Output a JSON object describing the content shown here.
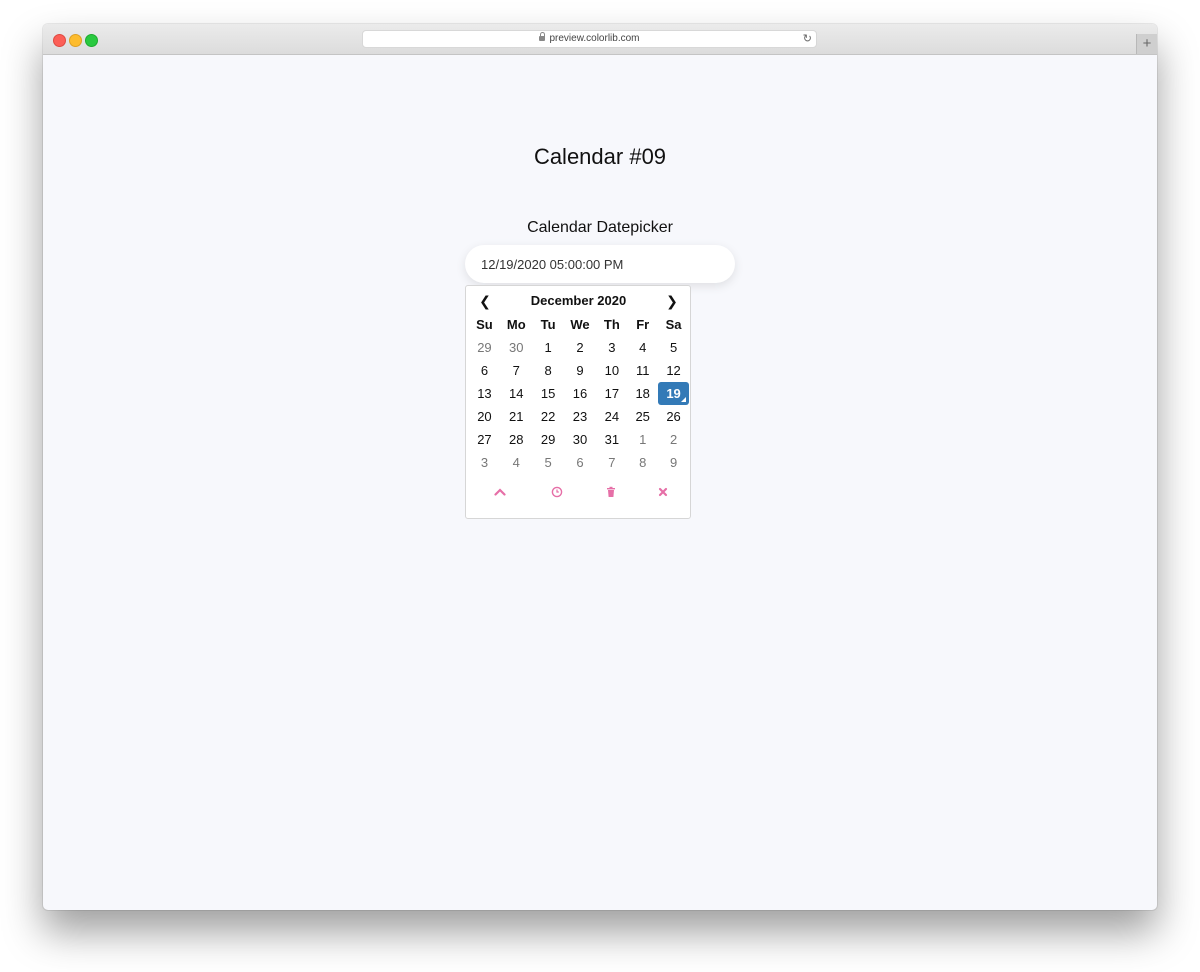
{
  "browser": {
    "url": "preview.colorlib.com",
    "new_tab_label": "+"
  },
  "page": {
    "title": "Calendar #09",
    "picker_label": "Calendar Datepicker",
    "input_value": "12/19/2020 05:00:00 PM"
  },
  "calendar": {
    "month_label": "December 2020",
    "prev_glyph": "❮",
    "next_glyph": "❯",
    "weekdays": [
      "Su",
      "Mo",
      "Tu",
      "We",
      "Th",
      "Fr",
      "Sa"
    ],
    "weeks": [
      [
        "29",
        "30",
        "1",
        "2",
        "3",
        "4",
        "5"
      ],
      [
        "6",
        "7",
        "8",
        "9",
        "10",
        "11",
        "12"
      ],
      [
        "13",
        "14",
        "15",
        "16",
        "17",
        "18",
        "19"
      ],
      [
        "20",
        "21",
        "22",
        "23",
        "24",
        "25",
        "26"
      ],
      [
        "27",
        "28",
        "29",
        "30",
        "31",
        "1",
        "2"
      ],
      [
        "3",
        "4",
        "5",
        "6",
        "7",
        "8",
        "9"
      ]
    ],
    "selected_day": "19",
    "accent_color": "#337ab7",
    "toolbar": {
      "collapse_icon": "chevron-up-icon",
      "time_icon": "clock-icon",
      "clear_icon": "trash-icon",
      "close_icon": "close-icon",
      "icon_color": "#e66fa7"
    }
  }
}
